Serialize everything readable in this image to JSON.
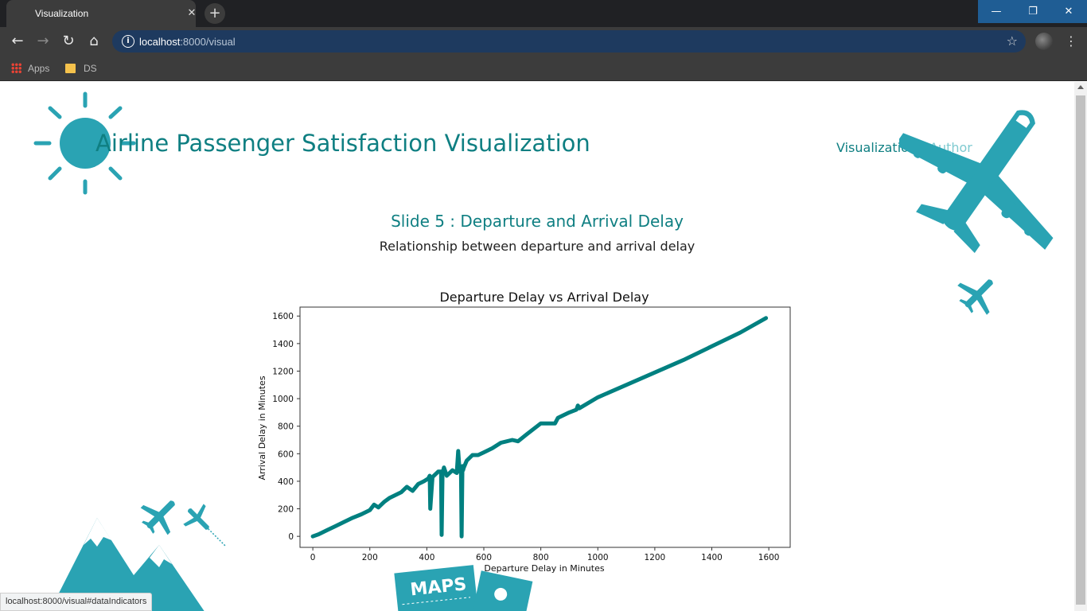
{
  "browser": {
    "tab_title": "Visualization",
    "url_host": "localhost",
    "url_path": ":8000/visual",
    "bookmarks": [
      {
        "label": "Apps",
        "icon": "apps-grid-icon"
      },
      {
        "label": "DS",
        "icon": "folder-icon"
      }
    ],
    "status_url": "localhost:8000/visual#dataIndicators"
  },
  "site": {
    "title": "Airline Passenger Satisfaction Visualization",
    "nav": [
      "Visualization",
      "Author"
    ],
    "accent_color": "#0f7f82",
    "deco_color": "#2aa3b3"
  },
  "slide": {
    "title": "Slide 5 : Departure and Arrival Delay",
    "subtitle": "Relationship between departure and arrival delay"
  },
  "chart_data": {
    "type": "line",
    "title": "Departure Delay vs Arrival Delay",
    "xlabel": "Departure Delay in Minutes",
    "ylabel": "Arrival Delay in Minutes",
    "xlim": [
      -45,
      1675
    ],
    "ylim": [
      -80,
      1665
    ],
    "xticks": [
      0,
      200,
      400,
      600,
      800,
      1000,
      1200,
      1400,
      1600
    ],
    "yticks": [
      0,
      200,
      400,
      600,
      800,
      1000,
      1200,
      1400,
      1600
    ],
    "grid": false,
    "color": "#008080",
    "series": [
      {
        "x": [
          0,
          20,
          50,
          80,
          110,
          140,
          170,
          200,
          215,
          230,
          250,
          270,
          290,
          310,
          330,
          350,
          370,
          390,
          405,
          410,
          412,
          420,
          440,
          450,
          452,
          455,
          460,
          470,
          490,
          505,
          510,
          515,
          520,
          522,
          525,
          527,
          530,
          540,
          560,
          580,
          600,
          630,
          660,
          700,
          720,
          750,
          800,
          850,
          860,
          900,
          925,
          930,
          935,
          1000,
          1100,
          1200,
          1300,
          1400,
          1500,
          1590
        ],
        "y": [
          0,
          15,
          45,
          75,
          105,
          135,
          160,
          190,
          230,
          210,
          250,
          280,
          300,
          320,
          360,
          330,
          380,
          400,
          420,
          440,
          200,
          430,
          470,
          470,
          10,
          460,
          500,
          440,
          480,
          460,
          620,
          470,
          500,
          0,
          510,
          480,
          500,
          550,
          590,
          590,
          610,
          640,
          680,
          700,
          690,
          740,
          820,
          820,
          860,
          900,
          920,
          950,
          930,
          1010,
          1100,
          1190,
          1280,
          1380,
          1480,
          1585
        ]
      }
    ]
  }
}
